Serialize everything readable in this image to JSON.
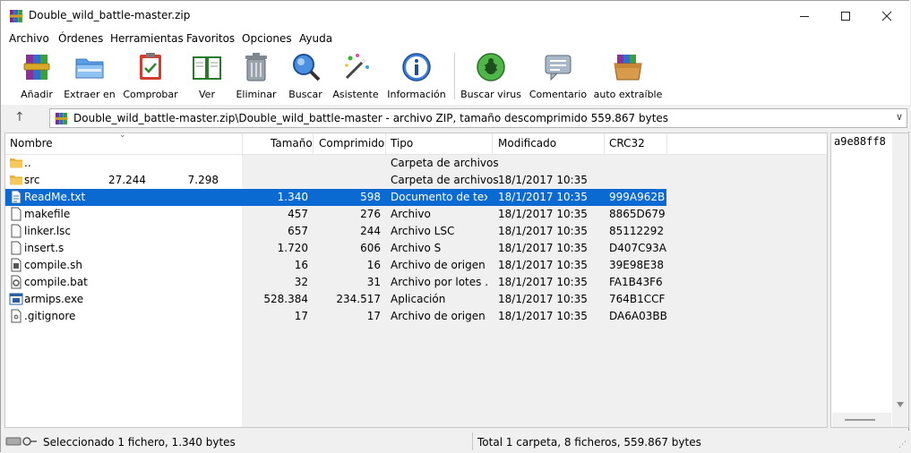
{
  "window": {
    "title": "Double_wild_battle-master.zip",
    "min_icon": "minimize-icon",
    "max_icon": "maximize-icon",
    "close_icon": "close-icon"
  },
  "menu": [
    "Archivo",
    "Órdenes",
    "Herramientas",
    "Favoritos",
    "Opciones",
    "Ayuda"
  ],
  "toolbar": [
    {
      "label": "Añadir",
      "icon": "add-archive-icon"
    },
    {
      "label": "Extraer en",
      "icon": "extract-folder-icon"
    },
    {
      "label": "Comprobar",
      "icon": "test-clipboard-icon"
    },
    {
      "label": "Ver",
      "icon": "view-book-icon"
    },
    {
      "label": "Eliminar",
      "icon": "trash-icon"
    },
    {
      "label": "Buscar",
      "icon": "magnifier-icon"
    },
    {
      "label": "Asistente",
      "icon": "wizard-wand-icon"
    },
    {
      "label": "Información",
      "icon": "info-icon"
    },
    {
      "label": "Buscar virus",
      "icon": "virus-scan-icon"
    },
    {
      "label": "Comentario",
      "icon": "comment-icon"
    },
    {
      "label": "auto extraíble",
      "icon": "sfx-box-icon"
    }
  ],
  "address": {
    "text": "Double_wild_battle-master.zip\\Double_wild_battle-master - archivo ZIP, tamaño descomprimido 559.867 bytes",
    "up_icon": "up-arrow-icon",
    "dropdown_icon": "chevron-down-icon"
  },
  "columns": [
    "Nombre",
    "Tamaño",
    "Comprimido",
    "Tipo",
    "Modificado",
    "CRC32"
  ],
  "files": [
    {
      "name": "..",
      "size": "",
      "packed": "",
      "type": "Carpeta de archivos",
      "modified": "",
      "crc": "",
      "icon": "folder-icon"
    },
    {
      "name": "src",
      "size": "27.244",
      "packed": "7.298",
      "type": "Carpeta de archivos",
      "modified": "18/1/2017 10:35",
      "crc": "",
      "icon": "folder-icon"
    },
    {
      "name": "ReadMe.txt",
      "size": "1.340",
      "packed": "598",
      "type": "Documento de tex...",
      "modified": "18/1/2017 10:35",
      "crc": "999A962B",
      "icon": "text-document-icon",
      "selected": true
    },
    {
      "name": "makefile",
      "size": "457",
      "packed": "276",
      "type": "Archivo",
      "modified": "18/1/2017 10:35",
      "crc": "8865D679",
      "icon": "blank-file-icon"
    },
    {
      "name": "linker.lsc",
      "size": "657",
      "packed": "244",
      "type": "Archivo LSC",
      "modified": "18/1/2017 10:35",
      "crc": "85112292",
      "icon": "blank-file-icon"
    },
    {
      "name": "insert.s",
      "size": "1.720",
      "packed": "606",
      "type": "Archivo S",
      "modified": "18/1/2017 10:35",
      "crc": "D407C93A",
      "icon": "blank-file-icon"
    },
    {
      "name": "compile.sh",
      "size": "16",
      "packed": "16",
      "type": "Archivo de origen ...",
      "modified": "18/1/2017 10:35",
      "crc": "39E98E38",
      "icon": "script-file-icon"
    },
    {
      "name": "compile.bat",
      "size": "32",
      "packed": "31",
      "type": "Archivo por lotes ...",
      "modified": "18/1/2017 10:35",
      "crc": "FA1B43F6",
      "icon": "batch-file-icon"
    },
    {
      "name": "armips.exe",
      "size": "528.384",
      "packed": "234.517",
      "type": "Aplicación",
      "modified": "18/1/2017 10:35",
      "crc": "764B1CCF",
      "icon": "application-icon"
    },
    {
      "name": ".gitignore",
      "size": "17",
      "packed": "17",
      "type": "Archivo de origen ...",
      "modified": "18/1/2017 10:35",
      "crc": "DA6A03BB",
      "icon": "config-file-icon"
    }
  ],
  "side_panel": {
    "text": "a9e88ff8"
  },
  "status": {
    "left": "Seleccionado 1 fichero, 1.340 bytes",
    "right": "Total 1 carpeta, 8 ficheros, 559.867 bytes",
    "drive_icon": "drive-key-icon"
  }
}
